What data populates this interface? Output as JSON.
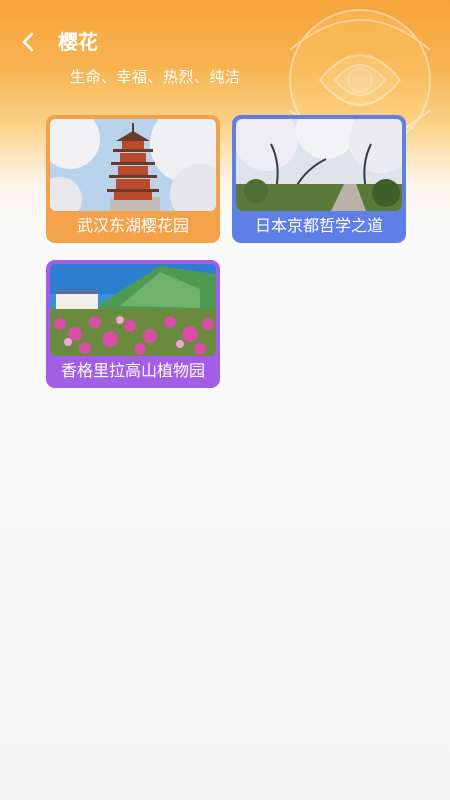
{
  "header": {
    "title": "樱花",
    "subtitle": "生命、幸福、热烈、纯洁"
  },
  "icons": {
    "back": "back-arrow-icon",
    "background": "rose-decoration"
  },
  "colors": {
    "header_orange": "#f6a43a",
    "card1": "#f3a24a",
    "card2": "#5f7ee6",
    "card3": "#a25ee6"
  },
  "cards": [
    {
      "label": "武汉东湖樱花园",
      "image": "pagoda-cherry-blossom"
    },
    {
      "label": "日本京都哲学之道",
      "image": "cherry-blossom-path"
    },
    {
      "label": "香格里拉高山植物园",
      "image": "alpine-flower-garden"
    }
  ]
}
